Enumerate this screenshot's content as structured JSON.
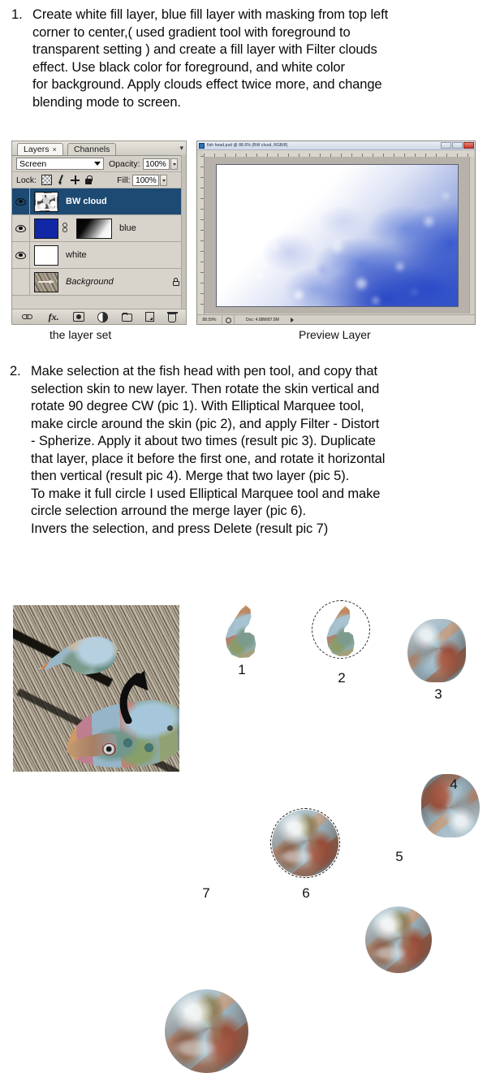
{
  "steps": [
    {
      "number": "1.",
      "lines": [
        "Create white fill layer, blue fill layer with masking from top left",
        "corner to center,( used gradient tool with foreground to",
        "transparent setting )  and create a fill layer with Filter clouds",
        "effect. Use black color for foreground, and white color",
        "for background. Apply clouds effect twice more, and change",
        "blending mode to screen."
      ]
    },
    {
      "number": "2.",
      "lines": [
        "Make selection at the fish head with pen tool, and copy that",
        "selection skin to new layer. Then rotate the skin vertical and",
        "rotate 90 degree CW (pic 1). With Elliptical Marquee tool,",
        "make circle around the skin (pic 2), and apply Filter - Distort",
        "- Spherize. Apply it about two times (result pic 3). Duplicate",
        "that layer, place it before the first one, and rotate it horizontal",
        "then vertical (result pic 4). Merge that two layer (pic 5).",
        "To make it full circle I used Elliptical Marquee tool and make",
        "circle selection arround the merge layer (pic 6).",
        "Invers the selection, and press Delete (result pic 7)"
      ]
    }
  ],
  "captions": {
    "layer_set": "the layer set",
    "preview": "Preview Layer"
  },
  "layers_panel": {
    "tabs": [
      {
        "label": "Layers",
        "close": "×",
        "active": true
      },
      {
        "label": "Channels",
        "close": "",
        "active": false
      }
    ],
    "menu_arrow": "▾",
    "blend_mode": "Screen",
    "opacity_label": "Opacity:",
    "opacity_value": "100%",
    "lock_label": "Lock:",
    "fill_label": "Fill:",
    "fill_value": "100%",
    "lock_icons": [
      "transparency-lock-icon",
      "brush-lock-icon",
      "move-lock-icon",
      "all-lock-icon"
    ],
    "layers": [
      {
        "name": "BW cloud",
        "visible": true,
        "selected": true,
        "thumb": "bw-cloud",
        "has_mask": false,
        "locked": false,
        "italic": false
      },
      {
        "name": "blue",
        "visible": true,
        "selected": false,
        "thumb": "blue-fill",
        "has_mask": true,
        "locked": false,
        "italic": false
      },
      {
        "name": "white",
        "visible": true,
        "selected": false,
        "thumb": "white-fill",
        "has_mask": false,
        "locked": false,
        "italic": false
      },
      {
        "name": "Background",
        "visible": false,
        "selected": false,
        "thumb": "deck-photo",
        "has_mask": false,
        "locked": true,
        "italic": true
      }
    ],
    "bottom_tools": [
      "link-layers-icon",
      "layer-style-fx-icon",
      "add-layer-mask-icon",
      "new-adjustment-layer-icon",
      "new-group-icon",
      "new-layer-icon",
      "delete-layer-icon"
    ],
    "colors": {
      "selected_row": "#1c4a72",
      "panel_bg": "#d4d0c8",
      "blue_fill": "#1028a6"
    }
  },
  "preview_window": {
    "title": "fish head.psd @ 88.6% (BW cloud, RGB/8)",
    "window_buttons": [
      "minimize-button",
      "maximize-button",
      "close-button"
    ],
    "status_zoom": "88.59%",
    "status_doc": "Doc: 4.88M/87.8M",
    "rulers": [
      "horizontal-ruler",
      "vertical-ruler"
    ]
  },
  "figures": {
    "photo": {
      "name": "fish-head-photo",
      "description": "fish head on wooden deck with pen-tool selection and arrow"
    },
    "pics": [
      {
        "label": "1",
        "name": "pic-1-rotated-skin"
      },
      {
        "label": "2",
        "name": "pic-2-elliptical-marquee"
      },
      {
        "label": "3",
        "name": "pic-3-spherized"
      },
      {
        "label": "4",
        "name": "pic-4-flipped-duplicate"
      },
      {
        "label": "5",
        "name": "pic-5-merged-sphere"
      },
      {
        "label": "6",
        "name": "pic-6-circle-selection"
      },
      {
        "label": "7",
        "name": "pic-7-final-marble"
      }
    ]
  }
}
